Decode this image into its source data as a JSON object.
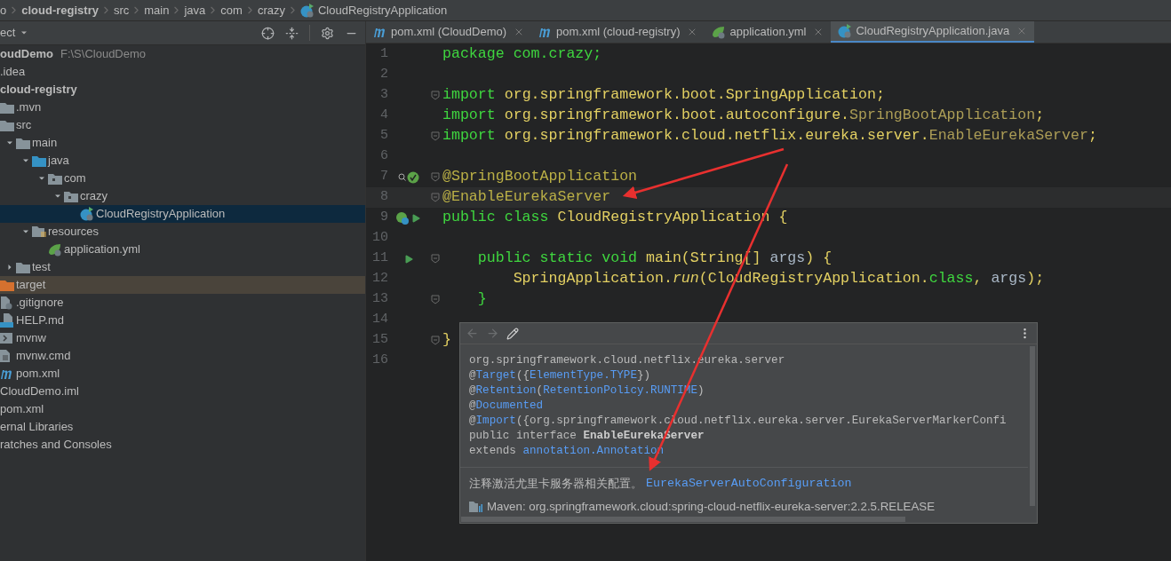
{
  "breadcrumb": [
    {
      "label": "o",
      "kind": "dir"
    },
    {
      "label": "cloud-registry",
      "kind": "module"
    },
    {
      "label": "src",
      "kind": "dir"
    },
    {
      "label": "main",
      "kind": "dir"
    },
    {
      "label": "java",
      "kind": "dir"
    },
    {
      "label": "com",
      "kind": "dir"
    },
    {
      "label": "crazy",
      "kind": "dir"
    },
    {
      "label": "CloudRegistryApplication",
      "kind": "class"
    }
  ],
  "project_panel": {
    "title": "ect",
    "tree": [
      {
        "label": "oudDemo",
        "path": "F:\\S\\CloudDemo",
        "kind": "project",
        "selected": false,
        "children": [
          {
            "label": ".idea",
            "selected": false
          },
          {
            "label": "cloud-registry",
            "kind": "module",
            "selected": false,
            "children": [
              {
                "label": ".mvn",
                "kind": "folder",
                "selected": false
              },
              {
                "label": "src",
                "kind": "folder",
                "selected": false,
                "children": [
                  {
                    "label": "main",
                    "kind": "folder",
                    "selected": false,
                    "expanded": true,
                    "children": [
                      {
                        "label": "java",
                        "kind": "source",
                        "selected": false,
                        "expanded": true,
                        "children": [
                          {
                            "label": "com",
                            "kind": "package",
                            "selected": false,
                            "expanded": true,
                            "children": [
                              {
                                "label": "crazy",
                                "kind": "package",
                                "selected": false,
                                "expanded": true,
                                "children": [
                                  {
                                    "label": "CloudRegistryApplication",
                                    "kind": "class",
                                    "selected": true
                                  }
                                ]
                              }
                            ]
                          }
                        ]
                      },
                      {
                        "label": "resources",
                        "kind": "resources",
                        "selected": false,
                        "expanded": true,
                        "children": [
                          {
                            "label": "application.yml",
                            "kind": "yml",
                            "selected": false
                          }
                        ]
                      }
                    ]
                  },
                  {
                    "label": "test",
                    "kind": "folder",
                    "selected": false,
                    "expanded": false
                  }
                ]
              },
              {
                "label": "target",
                "kind": "excluded",
                "selected": false
              },
              {
                "label": ".gitignore",
                "kind": "ignore",
                "selected": false
              },
              {
                "label": "HELP.md",
                "kind": "md",
                "selected": false
              },
              {
                "label": "mvnw",
                "kind": "script",
                "selected": false
              },
              {
                "label": "mvnw.cmd",
                "kind": "file",
                "selected": false
              },
              {
                "label": "pom.xml",
                "kind": "maven",
                "selected": false
              }
            ]
          },
          {
            "label": "CloudDemo.iml",
            "selected": false
          },
          {
            "label": "pom.xml",
            "selected": false
          }
        ]
      },
      {
        "label": "ernal Libraries",
        "selected": false
      },
      {
        "label": "ratches and Consoles",
        "selected": false
      }
    ]
  },
  "tabs": [
    {
      "label": "pom.xml (CloudDemo)",
      "kind": "maven",
      "selected": false
    },
    {
      "label": "pom.xml (cloud-registry)",
      "kind": "maven",
      "selected": false
    },
    {
      "label": "application.yml",
      "kind": "yml",
      "selected": false
    },
    {
      "label": "CloudRegistryApplication.java",
      "kind": "class",
      "selected": true
    }
  ],
  "code": [
    {
      "number": "1",
      "tokens": [
        {
          "text": "package com.crazy;",
          "kind": "keyword"
        }
      ]
    },
    {
      "number": "2"
    },
    {
      "number": "3",
      "fold": true,
      "tokens": [
        {
          "text": "import ",
          "kind": "keyword"
        },
        {
          "text": "org.springframework.boot.SpringApplication;",
          "kind": "ident"
        }
      ]
    },
    {
      "number": "4",
      "tokens": [
        {
          "text": "import ",
          "kind": "keyword"
        },
        {
          "text": "org.springframework.boot.autoconfigure.",
          "kind": "ident"
        },
        {
          "text": "SpringBootApplication",
          "kind": "unused"
        },
        {
          "text": ";",
          "kind": "ident"
        }
      ]
    },
    {
      "number": "5",
      "fold": true,
      "tokens": [
        {
          "text": "import ",
          "kind": "keyword"
        },
        {
          "text": "org.springframework.cloud.netflix.eureka.server.",
          "kind": "ident"
        },
        {
          "text": "EnableEurekaServer",
          "kind": "unused"
        },
        {
          "text": ";",
          "kind": "ident"
        }
      ]
    },
    {
      "number": "6"
    },
    {
      "number": "7",
      "fold": true,
      "usages": true,
      "bean": true,
      "tokens": [
        {
          "text": "@SpringBootApplication",
          "kind": "annotation"
        }
      ]
    },
    {
      "number": "8",
      "fold": true,
      "current": true,
      "tokens": [
        {
          "text": "@EnableEurekaServer",
          "kind": "annotation"
        }
      ]
    },
    {
      "number": "9",
      "run": true,
      "bean": true,
      "tokens": [
        {
          "text": "public class ",
          "kind": "keyword"
        },
        {
          "text": "CloudRegistryApplication {",
          "kind": "ident"
        }
      ]
    },
    {
      "number": "10"
    },
    {
      "number": "11",
      "run": true,
      "fold": true,
      "tokens": [
        {
          "text": "    public static void ",
          "kind": "keyword"
        },
        {
          "text": "main(String[] ",
          "kind": "ident"
        },
        {
          "text": "args",
          "kind": "param"
        },
        {
          "text": ") {",
          "kind": "ident"
        }
      ]
    },
    {
      "number": "12",
      "tokens": [
        {
          "text": "        SpringApplication.",
          "kind": "ident"
        },
        {
          "text": "run",
          "kind": "method"
        },
        {
          "text": "(CloudRegistryApplication.",
          "kind": "ident"
        },
        {
          "text": "class",
          "kind": "keyword"
        },
        {
          "text": ", ",
          "kind": "ident"
        },
        {
          "text": "args",
          "kind": "param"
        },
        {
          "text": ");",
          "kind": "ident"
        }
      ]
    },
    {
      "number": "13",
      "fold": true,
      "tokens": [
        {
          "text": "    }",
          "kind": "keyword"
        }
      ]
    },
    {
      "number": "14"
    },
    {
      "number": "15",
      "fold": true,
      "tokens": [
        {
          "text": "}",
          "kind": "ident"
        }
      ]
    },
    {
      "number": "16"
    }
  ],
  "doc_popup": {
    "lines": [
      [
        {
          "text": "org.springframework.cloud.netflix.eureka.server",
          "kind": "plain"
        }
      ],
      [
        {
          "text": "@",
          "kind": "plain"
        },
        {
          "text": "Target",
          "kind": "link"
        },
        {
          "text": "({",
          "kind": "plain"
        },
        {
          "text": "ElementType.TYPE",
          "kind": "link"
        },
        {
          "text": "})",
          "kind": "plain"
        }
      ],
      [
        {
          "text": "@",
          "kind": "plain"
        },
        {
          "text": "Retention",
          "kind": "link"
        },
        {
          "text": "(",
          "kind": "plain"
        },
        {
          "text": "RetentionPolicy.RUNTIME",
          "kind": "link"
        },
        {
          "text": ")",
          "kind": "plain"
        }
      ],
      [
        {
          "text": "@",
          "kind": "plain"
        },
        {
          "text": "Documented",
          "kind": "link"
        }
      ],
      [
        {
          "text": "@",
          "kind": "plain"
        },
        {
          "text": "Import",
          "kind": "link"
        },
        {
          "text": "({org.springframework.cloud.netflix.eureka.server.EurekaServerMarkerConfi",
          "kind": "plain"
        }
      ],
      [
        {
          "text": "public interface ",
          "kind": "plain"
        },
        {
          "text": "EnableEurekaServer",
          "kind": "bold"
        }
      ],
      [
        {
          "text": "extends ",
          "kind": "plain"
        },
        {
          "text": "annotation.Annotation",
          "kind": "link"
        }
      ]
    ],
    "description": "注释激活尤里卡服务器相关配置。",
    "description_link": "EurekaServerAutoConfiguration",
    "library": "Maven: org.springframework.cloud:spring-cloud-netflix-eureka-server:2.2.5.RELEASE"
  }
}
